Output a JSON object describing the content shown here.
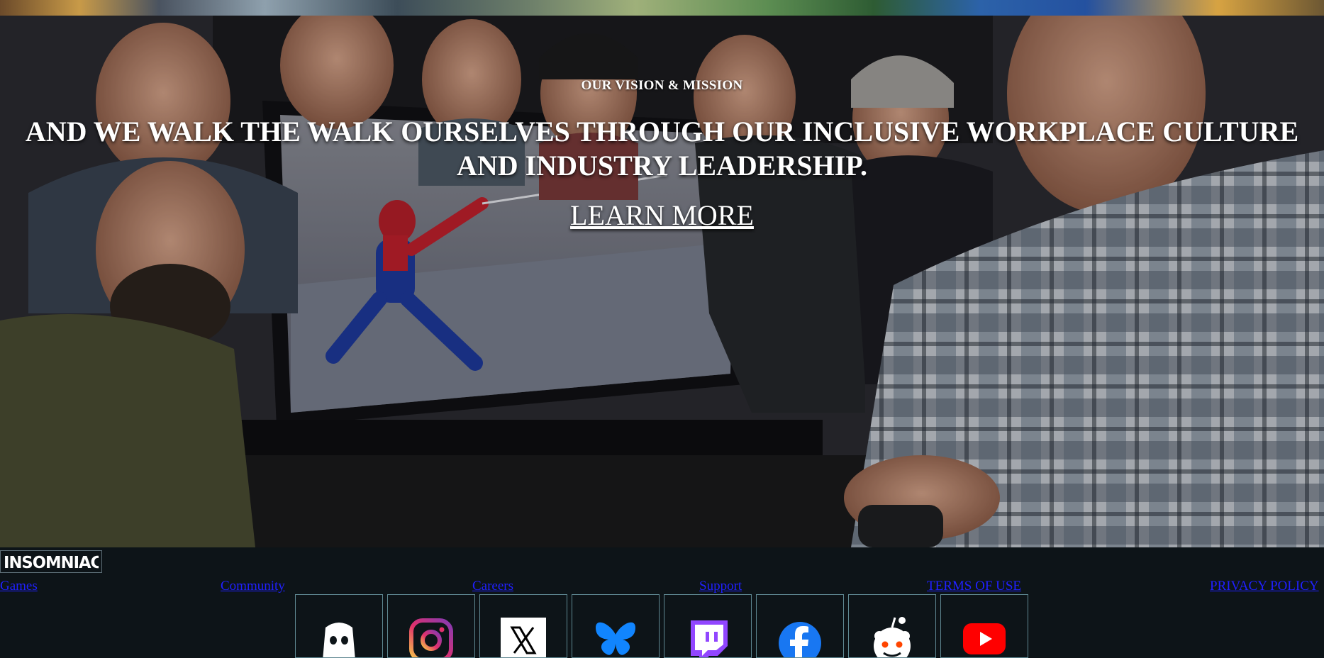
{
  "hero": {
    "eyebrow": "OUR VISION & MISSION",
    "headline": "AND WE WALK THE WALK OURSELVES THROUGH OUR INCLUSIVE WORKPLACE CULTURE AND INDUSTRY LEADERSHIP.",
    "cta_label": "LEARN MORE"
  },
  "footer": {
    "logo_text": "INSOMNIAC",
    "links": [
      "Games",
      "Community",
      "Careers",
      "Support",
      "TERMS OF USE",
      "PRIVACY POLICY"
    ],
    "social_icons": [
      "discord-icon",
      "instagram-icon",
      "x-icon",
      "bluesky-icon",
      "twitch-icon",
      "facebook-icon",
      "reddit-icon",
      "youtube-icon"
    ]
  },
  "colors": {
    "footer_bg": "#0d1418",
    "link": "#2020ff",
    "social_border": "#5f8892"
  }
}
